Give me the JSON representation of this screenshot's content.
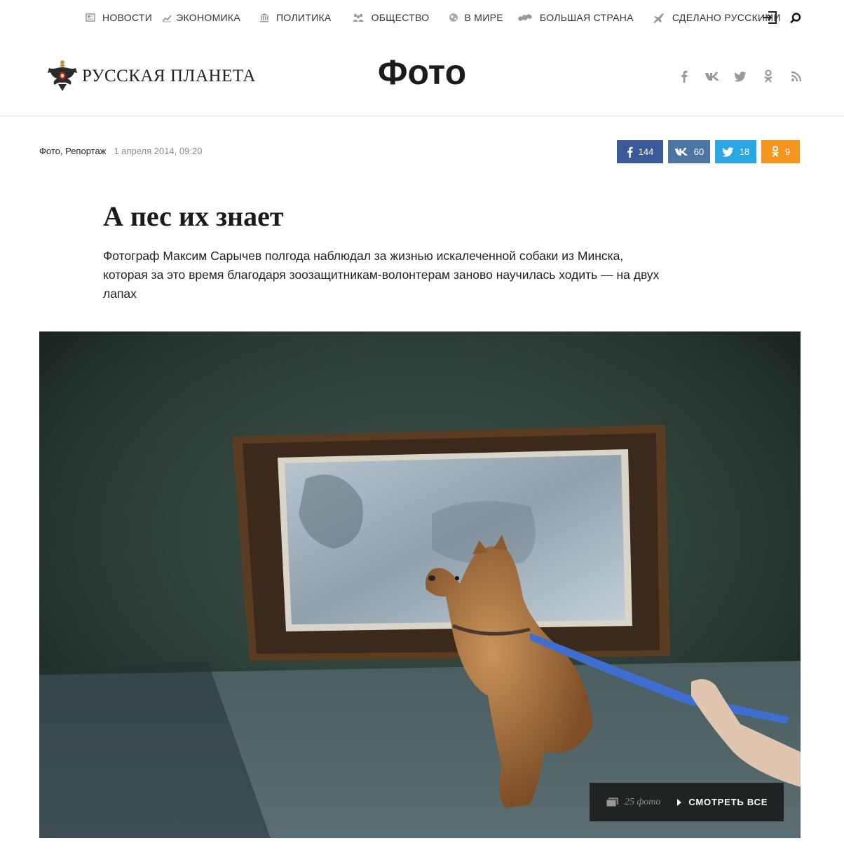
{
  "nav": {
    "items": [
      {
        "label": "НОВОСТИ",
        "icon": "news-icon"
      },
      {
        "label": "ЭКОНОМИКА",
        "icon": "chart-icon"
      },
      {
        "label": "ПОЛИТИКА",
        "icon": "building-icon"
      },
      {
        "label": "ОБЩЕСТВО",
        "icon": "people-icon"
      },
      {
        "label": "В МИРЕ",
        "icon": "globe-icon"
      },
      {
        "label": "БОЛЬШАЯ СТРАНА",
        "icon": "russia-map-icon"
      },
      {
        "label": "СДЕЛАНО РУССКИМИ",
        "icon": "plane-icon"
      }
    ]
  },
  "header": {
    "logo_text": "РУССКАЯ ПЛАНЕТА",
    "section_title": "Фото"
  },
  "meta": {
    "categories": "Фото, Репортаж",
    "date": "1 апреля 2014, 09:20"
  },
  "share": {
    "facebook": "144",
    "vkontakte": "60",
    "twitter": "18",
    "odnoklassniki": "9"
  },
  "article": {
    "title": "А пес их знает",
    "lead": "Фотограф Максим Сарычев полгода наблюдал за жизнью искалеченной собаки из Минска, которая за это время благодаря зоозащитникам-волонтерам заново научилась ходить — на двух лапах"
  },
  "gallery": {
    "count": "25 фото",
    "see_all": "СМОТРЕТЬ ВСЕ"
  },
  "colors": {
    "facebook": "#3b5998",
    "vkontakte": "#4c75a3",
    "twitter": "#2ba7e4",
    "odnoklassniki": "#f5961e"
  }
}
